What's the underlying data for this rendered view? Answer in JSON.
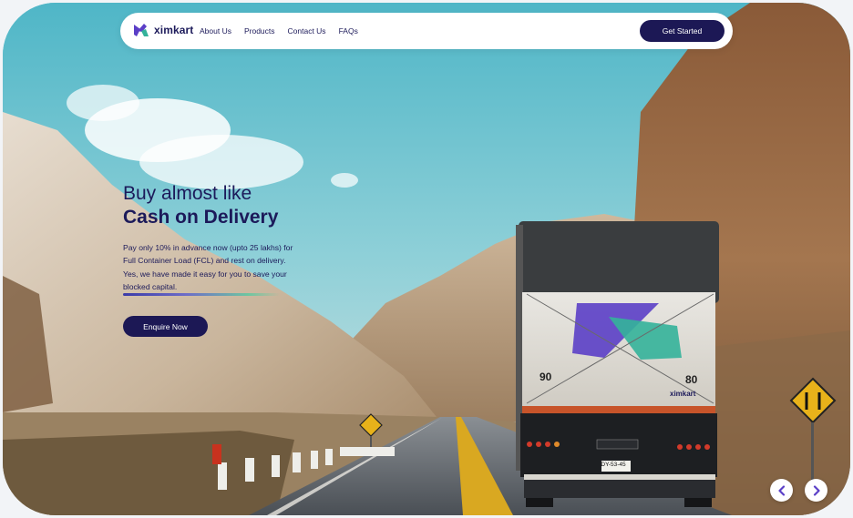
{
  "brand": {
    "name": "ximkart",
    "colors": {
      "navy": "#1c1855",
      "purple": "#5b3fc7",
      "teal": "#34b29a"
    }
  },
  "nav": {
    "links": [
      "About Us",
      "Products",
      "Contact Us",
      "FAQs"
    ],
    "cta_label": "Get Started"
  },
  "hero": {
    "headline_light": "Buy almost like",
    "headline_bold": "Cash on Delivery",
    "description": "Pay only 10% in advance now (upto 25 lakhs) for Full Container Load (FCL) and rest on delivery. Yes, we have made it easy for you to save your blocked capital.",
    "button_label": "Enquire Now"
  },
  "truck": {
    "left_number": "90",
    "right_number": "80",
    "plate": "DY-53-45",
    "logo_text": "ximkart"
  },
  "carousel": {
    "prev_icon": "chevron-left-icon",
    "next_icon": "chevron-right-icon"
  }
}
